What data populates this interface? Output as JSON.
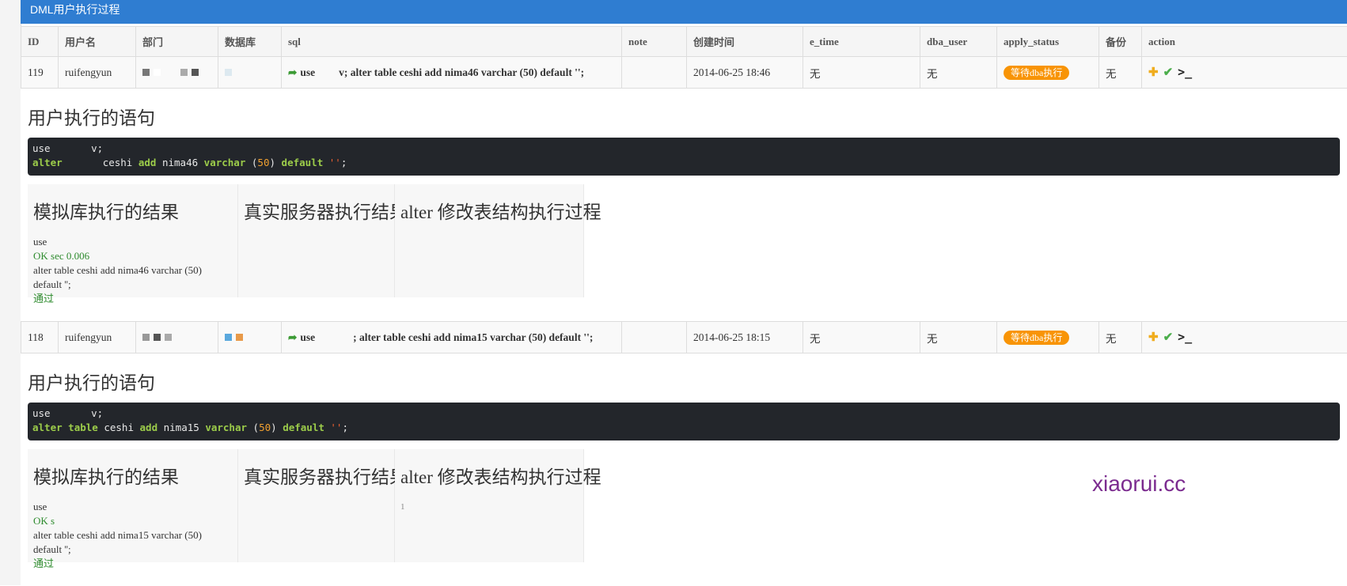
{
  "title": "DML用户执行过程",
  "columns": [
    "ID",
    "用户名",
    "部门",
    "数据库",
    "sql",
    "note",
    "创建时间",
    "e_time",
    "dba_user",
    "apply_status",
    "备份",
    "action"
  ],
  "rows": [
    {
      "id": "119",
      "user": "ruifengyun",
      "sql_prefix": "use",
      "sql_rest": "v; alter table ceshi add nima46 varchar (50) default '';",
      "note": "",
      "created": "2014-06-25 18:46",
      "e_time": "无",
      "dba_user": "无",
      "status": "等待dba执行",
      "backup": "无",
      "detail": {
        "heading": "用户执行的语句",
        "code_line1_use": "use",
        "code_line1_end": "v;",
        "code_line2": {
          "kw1": "alter",
          "tbl": "ceshi",
          "kw2": "add",
          "col": "nima46",
          "kw3": "varchar",
          "num": "50",
          "kw4": "default",
          "str": "''"
        },
        "panel1_title": "模拟库执行的结果",
        "panel2_title": "真实服务器执行结果",
        "panel3_title": "alter 修改表结构执行过程",
        "panel1_lines": [
          "use",
          "OK sec 0.006",
          "alter table ceshi add nima46 varchar (50) default '';",
          "通过"
        ]
      }
    },
    {
      "id": "118",
      "user": "ruifengyun",
      "sql_prefix": "use",
      "sql_rest": "; alter table ceshi add nima15 varchar (50) default '';",
      "note": "",
      "created": "2014-06-25 18:15",
      "e_time": "无",
      "dba_user": "无",
      "status": "等待dba执行",
      "backup": "无",
      "detail": {
        "heading": "用户执行的语句",
        "code_line1_use": "use",
        "code_line1_end": "v;",
        "code_line2": {
          "kw1": "alter",
          "kw1b": "table",
          "tbl": "ceshi",
          "kw2": "add",
          "col": "nima15",
          "kw3": "varchar",
          "num": "50",
          "kw4": "default",
          "str": "''"
        },
        "panel1_title": "模拟库执行的结果",
        "panel2_title": "真实服务器执行结果",
        "panel3_title": "alter 修改表结构执行过程",
        "panel1_lines": [
          "use",
          "OK s",
          "alter table ceshi add nima15 varchar (50) default '';",
          "通过"
        ],
        "panel3_text": "1"
      }
    }
  ],
  "watermark": "xiaorui.cc",
  "colors": {
    "titlebar": "#2f7dd1",
    "badge": "#f89406",
    "code_bg": "#23262b",
    "watermark": "#7b2b8f"
  }
}
